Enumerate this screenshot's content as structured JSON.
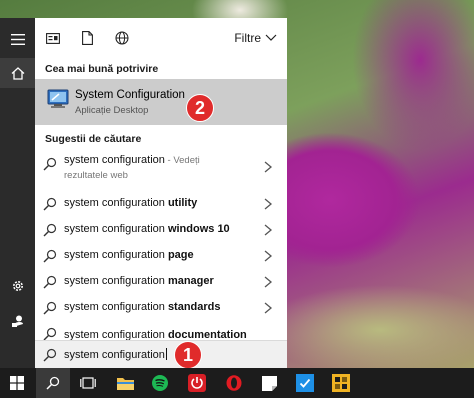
{
  "filter_bar": {
    "filter_label": "Filtre"
  },
  "best_match": {
    "heading": "Cea mai bună potrivire",
    "title": "System Configuration",
    "subtitle": "Aplicație Desktop",
    "badge": "2"
  },
  "suggestions": {
    "heading": "Sugestii de căutare",
    "items": [
      {
        "base": "system configuration",
        "bold": "",
        "suffix": " - Vedeți",
        "suffix2": "rezultatele web"
      },
      {
        "base": "system configuration ",
        "bold": "utility"
      },
      {
        "base": "system configuration ",
        "bold": "windows 10"
      },
      {
        "base": "system configuration ",
        "bold": "page"
      },
      {
        "base": "system configuration ",
        "bold": "manager"
      },
      {
        "base": "system configuration ",
        "bold": "standards"
      },
      {
        "base": "system configuration ",
        "bold": "documentation"
      }
    ]
  },
  "search": {
    "query": "system configuration",
    "badge": "1"
  },
  "colors": {
    "rail": "#2b2b2b",
    "best_match_bg": "#cccccc",
    "badge": "#e02b2b",
    "taskbar": "#1c1c1c"
  },
  "taskbar_icons": [
    "windows-start-icon",
    "search-icon",
    "task-view-icon",
    "file-explorer-icon",
    "spotify-icon",
    "power-app-icon",
    "opera-icon",
    "sticky-notes-icon",
    "todo-icon",
    "puzzle-app-icon"
  ]
}
